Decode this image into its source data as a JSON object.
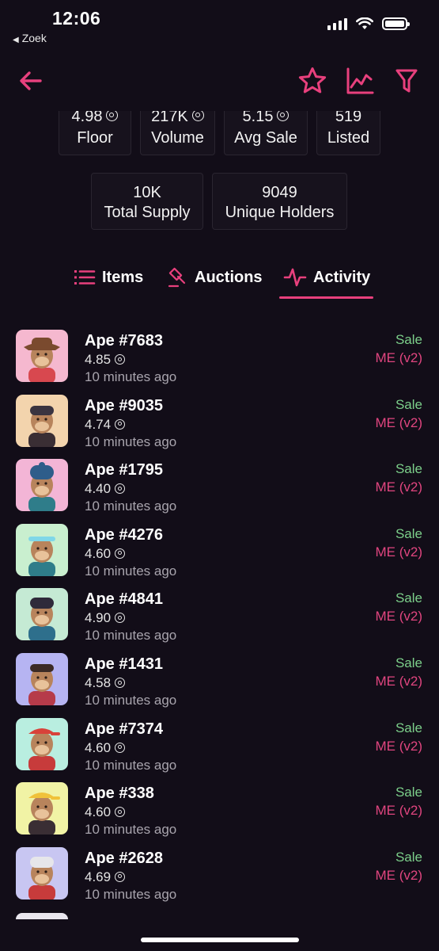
{
  "status_bar": {
    "time": "12:06",
    "back_app": "Zoek"
  },
  "nav": {
    "back_icon": "arrow-left-icon",
    "star_icon": "star-icon",
    "chart_icon": "line-chart-icon",
    "filter_icon": "filter-icon",
    "accent_color": "#e8407d"
  },
  "stats": {
    "row1": [
      {
        "value": "4.98",
        "label": "Floor",
        "currency": true
      },
      {
        "value": "217K",
        "label": "Volume",
        "currency": true
      },
      {
        "value": "5.15",
        "label": "Avg Sale",
        "currency": true
      },
      {
        "value": "519",
        "label": "Listed",
        "currency": false
      }
    ],
    "row2": [
      {
        "value": "10K",
        "label": "Total Supply"
      },
      {
        "value": "9049",
        "label": "Unique Holders"
      }
    ]
  },
  "tabs": [
    {
      "label": "Items",
      "icon": "list-icon"
    },
    {
      "label": "Auctions",
      "icon": "gavel-icon"
    },
    {
      "label": "Activity",
      "icon": "activity-icon",
      "selected": true
    }
  ],
  "activity": [
    {
      "name": "Ape #7683",
      "price": "4.85",
      "time": "10 minutes ago",
      "type": "Sale",
      "market": "ME (v2)",
      "bg": "#f5b8cf"
    },
    {
      "name": "Ape #9035",
      "price": "4.74",
      "time": "10 minutes ago",
      "type": "Sale",
      "market": "ME (v2)",
      "bg": "#f3d4ad"
    },
    {
      "name": "Ape #1795",
      "price": "4.40",
      "time": "10 minutes ago",
      "type": "Sale",
      "market": "ME (v2)",
      "bg": "#f3b5d6"
    },
    {
      "name": "Ape #4276",
      "price": "4.60",
      "time": "10 minutes ago",
      "type": "Sale",
      "market": "ME (v2)",
      "bg": "#c9efcf"
    },
    {
      "name": "Ape #4841",
      "price": "4.90",
      "time": "10 minutes ago",
      "type": "Sale",
      "market": "ME (v2)",
      "bg": "#c5ead4"
    },
    {
      "name": "Ape #1431",
      "price": "4.58",
      "time": "10 minutes ago",
      "type": "Sale",
      "market": "ME (v2)",
      "bg": "#b6b4f2"
    },
    {
      "name": "Ape #7374",
      "price": "4.60",
      "time": "10 minutes ago",
      "type": "Sale",
      "market": "ME (v2)",
      "bg": "#b9eee0"
    },
    {
      "name": "Ape #338",
      "price": "4.60",
      "time": "10 minutes ago",
      "type": "Sale",
      "market": "ME (v2)",
      "bg": "#f1f3a5"
    },
    {
      "name": "Ape #2628",
      "price": "4.69",
      "time": "10 minutes ago",
      "type": "Sale",
      "market": "ME (v2)",
      "bg": "#c8c6f2"
    }
  ]
}
